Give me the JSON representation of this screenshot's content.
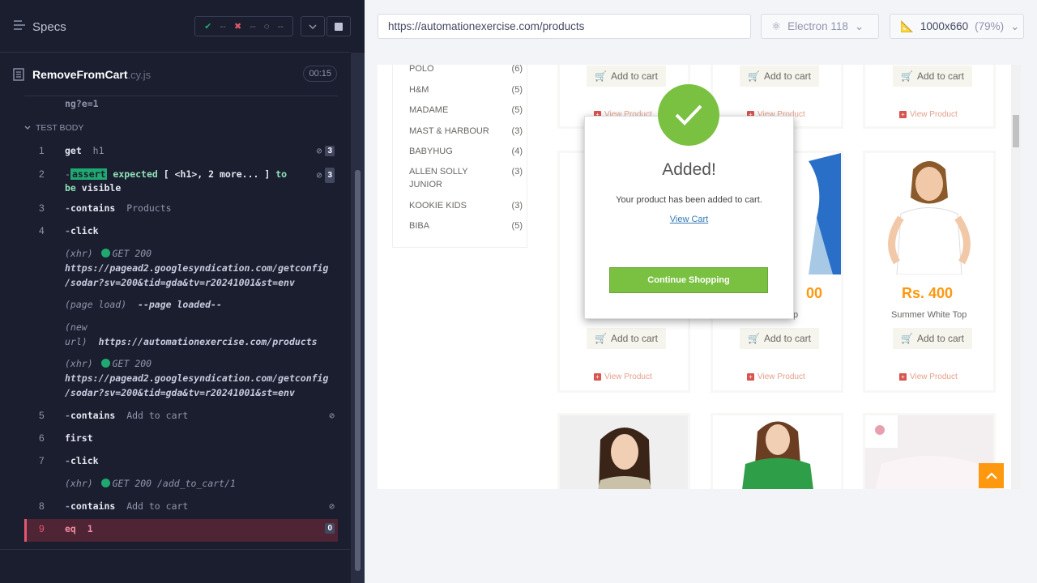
{
  "reporter": {
    "specs_label": "Specs",
    "stats": {
      "passed": "--",
      "failed": "--",
      "pending": "--"
    },
    "spec_file": {
      "name": "RemoveFromCart",
      "ext": ".cy.js",
      "duration": "00:15"
    },
    "prev_line": "ng?e=1",
    "section_label": "TEST BODY",
    "commands": [
      {
        "num": "1",
        "name": "get",
        "msg": "h1",
        "count": "3"
      },
      {
        "num": "2",
        "name": "assert",
        "msg_parts": [
          "expected",
          "[ <h1>, 2 more... ]",
          "to",
          "be",
          "visible"
        ],
        "count": "3"
      },
      {
        "num": "3",
        "name": "contains",
        "msg": "Products"
      },
      {
        "num": "4",
        "name": "click",
        "msg": ""
      },
      {
        "num": "5",
        "name": "contains",
        "msg": "Add to cart"
      },
      {
        "num": "6",
        "name": "first",
        "msg": ""
      },
      {
        "num": "7",
        "name": "click",
        "msg": ""
      },
      {
        "num": "8",
        "name": "contains",
        "msg": "Add to cart"
      },
      {
        "num": "9",
        "name": "eq",
        "msg": "1",
        "count": "0"
      }
    ],
    "logs": {
      "xhr1_type": "(xhr)",
      "xhr1_status": "GET 200",
      "xhr1_url1": "https://pagead2.googlesyndication.com/getconfig",
      "xhr1_url2": "/sodar?sv=200&tid=gda&tv=r20241001&st=env",
      "pageload_type": "(page load)",
      "pageload_msg": "--page loaded--",
      "newurl_type1": "(new",
      "newurl_type2": "url)",
      "newurl_url": "https://automationexercise.com/products",
      "xhr2_type": "(xhr)",
      "xhr2_status": "GET 200",
      "xhr2_url1": "https://pagead2.googlesyndication.com/getconfig",
      "xhr2_url2": "/sodar?sv=200&tid=gda&tv=r20241001&st=env",
      "xhr3_type": "(xhr)",
      "xhr3_status": "GET 200 /add_to_cart/1"
    }
  },
  "aut": {
    "url": "https://automationexercise.com/products",
    "browser": "Electron 118",
    "viewport": "1000x660",
    "scale": "(79%)"
  },
  "site": {
    "brands": [
      {
        "name": "POLO",
        "count": "(6)"
      },
      {
        "name": "H&M",
        "count": "(5)"
      },
      {
        "name": "MADAME",
        "count": "(5)"
      },
      {
        "name": "MAST & HARBOUR",
        "count": "(3)"
      },
      {
        "name": "BABYHUG",
        "count": "(4)"
      },
      {
        "name": "ALLEN SOLLY JUNIOR",
        "count": "(3)"
      },
      {
        "name": "KOOKIE KIDS",
        "count": "(3)"
      },
      {
        "name": "BIBA",
        "count": "(5)"
      }
    ],
    "add_to_cart": "Add to cart",
    "view_product": "View Product",
    "product_price": "Rs. 400",
    "product_name": "Summer White Top",
    "partial_price": "00",
    "partial_name": "p",
    "modal": {
      "title": "Added!",
      "text": "Your product has been added to cart.",
      "link": "View Cart",
      "button": "Continue Shopping"
    }
  }
}
